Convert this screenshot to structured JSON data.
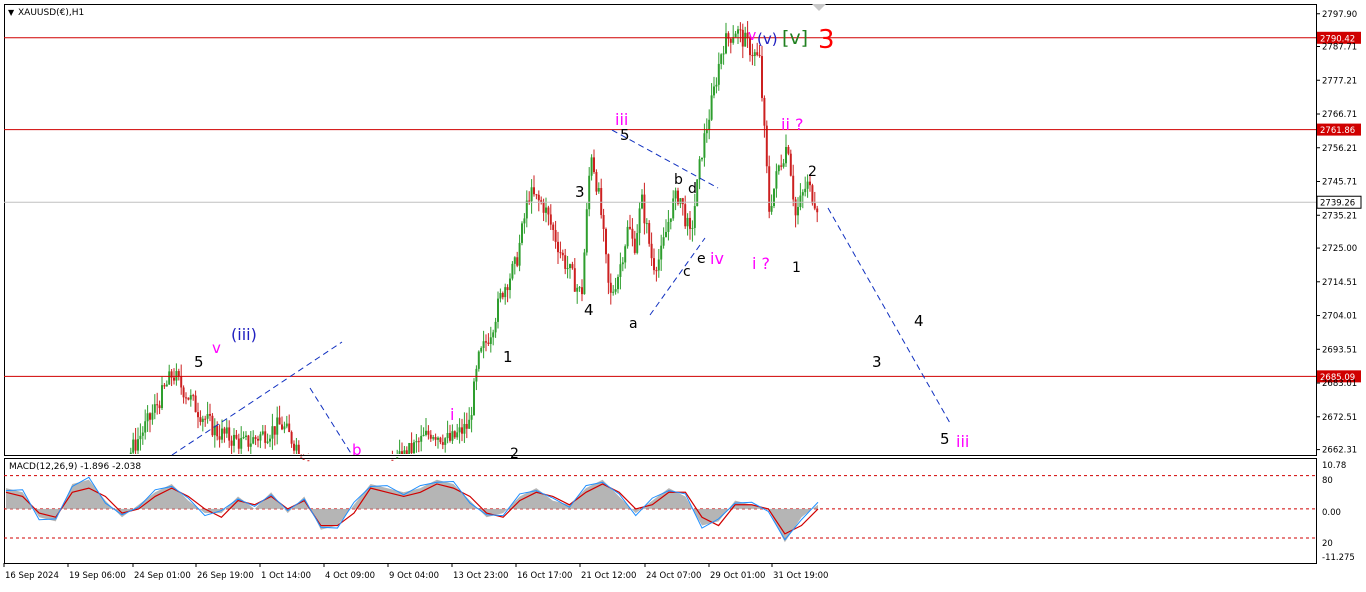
{
  "header": {
    "symbol_label": "XAUUSD(€),H1",
    "macd_label": "MACD(12,26,9) -1.896 -2.038"
  },
  "colors": {
    "bull": "#2e9e2e",
    "bear": "#cc2020",
    "hline": "#d00000",
    "grid": "#c0c0c0",
    "magenta": "#ff00ff",
    "blue": "#2020c0",
    "green": "#208020",
    "red": "#ff0000",
    "macd_fill": "#a8a8a8",
    "macd_line": "#1e8fff",
    "signal": "#d00000",
    "level": "#d00000"
  },
  "chart_data": [
    {
      "type": "candlestick",
      "title": "XAUUSD(€),H1",
      "ylim": [
        2660.0,
        2800.0
      ],
      "y_ticks": [
        "2797.90",
        "2787.71",
        "2777.21",
        "2766.71",
        "2756.21",
        "2745.71",
        "2735.21",
        "2725.00",
        "2714.51",
        "2704.01",
        "2693.51",
        "2683.01",
        "2672.51",
        "2662.31"
      ],
      "x_ticks": [
        "16 Sep 2024",
        "19 Sep 06:00",
        "24 Sep 01:00",
        "26 Sep 19:00",
        "1 Oct 14:00",
        "4 Oct 09:00",
        "9 Oct 04:00",
        "13 Oct 23:00",
        "16 Oct 17:00",
        "21 Oct 12:00",
        "24 Oct 07:00",
        "29 Oct 01:00",
        "31 Oct 19:00"
      ],
      "current_price": "2739.26",
      "horizontal_levels": [
        "2790.42",
        "2761.86",
        "2685.09"
      ],
      "price_path": [
        [
          0,
          2640
        ],
        [
          40,
          2645
        ],
        [
          60,
          2652
        ],
        [
          80,
          2672
        ],
        [
          92,
          2686
        ],
        [
          105,
          2675
        ],
        [
          115,
          2668
        ],
        [
          130,
          2664
        ],
        [
          150,
          2670
        ],
        [
          165,
          2658
        ],
        [
          175,
          2655
        ],
        [
          195,
          2650
        ],
        [
          215,
          2660
        ],
        [
          230,
          2668
        ],
        [
          240,
          2665
        ],
        [
          250,
          2670
        ],
        [
          255,
          2690
        ],
        [
          262,
          2700
        ],
        [
          268,
          2712
        ],
        [
          275,
          2720
        ],
        [
          282,
          2742
        ],
        [
          290,
          2738
        ],
        [
          300,
          2722
        ],
        [
          310,
          2710
        ],
        [
          315,
          2756
        ],
        [
          318,
          2745
        ],
        [
          320,
          2738
        ],
        [
          325,
          2709
        ],
        [
          330,
          2718
        ],
        [
          335,
          2732
        ],
        [
          338,
          2725
        ],
        [
          342,
          2740
        ],
        [
          348,
          2720
        ],
        [
          352,
          2722
        ],
        [
          358,
          2738
        ],
        [
          362,
          2742
        ],
        [
          368,
          2728
        ],
        [
          374,
          2755
        ],
        [
          380,
          2772
        ],
        [
          385,
          2788
        ],
        [
          392,
          2793
        ],
        [
          400,
          2787
        ],
        [
          405,
          2783
        ],
        [
          410,
          2737
        ],
        [
          415,
          2750
        ],
        [
          420,
          2758
        ],
        [
          424,
          2735
        ],
        [
          430,
          2745
        ],
        [
          436,
          2738
        ]
      ],
      "annotations": [
        {
          "text": "v",
          "color": "magenta"
        },
        {
          "text": "(v)",
          "color": "blue"
        },
        {
          "text": "[v]",
          "color": "green"
        },
        {
          "text": "3",
          "color": "red"
        },
        {
          "text": "iii",
          "color": "magenta"
        },
        {
          "text": "5",
          "color": "black"
        },
        {
          "text": "ii ?",
          "color": "magenta"
        },
        {
          "text": "2",
          "color": "black"
        },
        {
          "text": "3",
          "color": "black"
        },
        {
          "text": "b",
          "color": "black"
        },
        {
          "text": "d",
          "color": "black"
        },
        {
          "text": "c",
          "color": "black"
        },
        {
          "text": "e",
          "color": "black"
        },
        {
          "text": "iv",
          "color": "magenta"
        },
        {
          "text": "i ?",
          "color": "magenta"
        },
        {
          "text": "1",
          "color": "black"
        },
        {
          "text": "4",
          "color": "black"
        },
        {
          "text": "a",
          "color": "black"
        },
        {
          "text": "1",
          "color": "black"
        },
        {
          "text": "2",
          "color": "black"
        },
        {
          "text": "i",
          "color": "magenta"
        },
        {
          "text": "5",
          "color": "black"
        },
        {
          "text": "v",
          "color": "magenta"
        },
        {
          "text": "(iii)",
          "color": "blue"
        },
        {
          "text": "b",
          "color": "magenta"
        },
        {
          "text": "4",
          "color": "black"
        },
        {
          "text": "3",
          "color": "black"
        },
        {
          "text": "5",
          "color": "black"
        },
        {
          "text": "iii",
          "color": "magenta"
        }
      ]
    },
    {
      "type": "line",
      "title": "MACD(12,26,9) -1.896 -2.038",
      "ylim": [
        -13.0,
        12.0
      ],
      "y_ticks": [
        "10.78",
        "80",
        "0.00",
        "20",
        "-11.275"
      ],
      "series": [
        {
          "values": [
            5,
            4,
            -2,
            -3,
            6,
            7,
            2,
            -2,
            1,
            4,
            6,
            2,
            -1,
            -1,
            3,
            0,
            4,
            -1,
            3,
            -5,
            -4,
            1,
            6,
            5,
            4,
            5,
            7,
            6,
            2,
            -2,
            -1,
            3,
            5,
            2,
            1,
            5,
            7,
            3,
            -1,
            2,
            5,
            3,
            -4,
            -3,
            2,
            1,
            0,
            -8,
            -2,
            1
          ]
        },
        {
          "values": [
            4,
            3,
            -1,
            -2,
            4,
            5,
            3,
            -1,
            0,
            3,
            5,
            3,
            0,
            -2,
            2,
            1,
            3,
            0,
            2,
            -4,
            -4,
            -1,
            5,
            4,
            3,
            4,
            6,
            5,
            3,
            -1,
            -2,
            2,
            4,
            3,
            1,
            4,
            6,
            4,
            0,
            1,
            4,
            4,
            -2,
            -4,
            1,
            1,
            0,
            -6,
            -4,
            0
          ]
        }
      ]
    }
  ]
}
